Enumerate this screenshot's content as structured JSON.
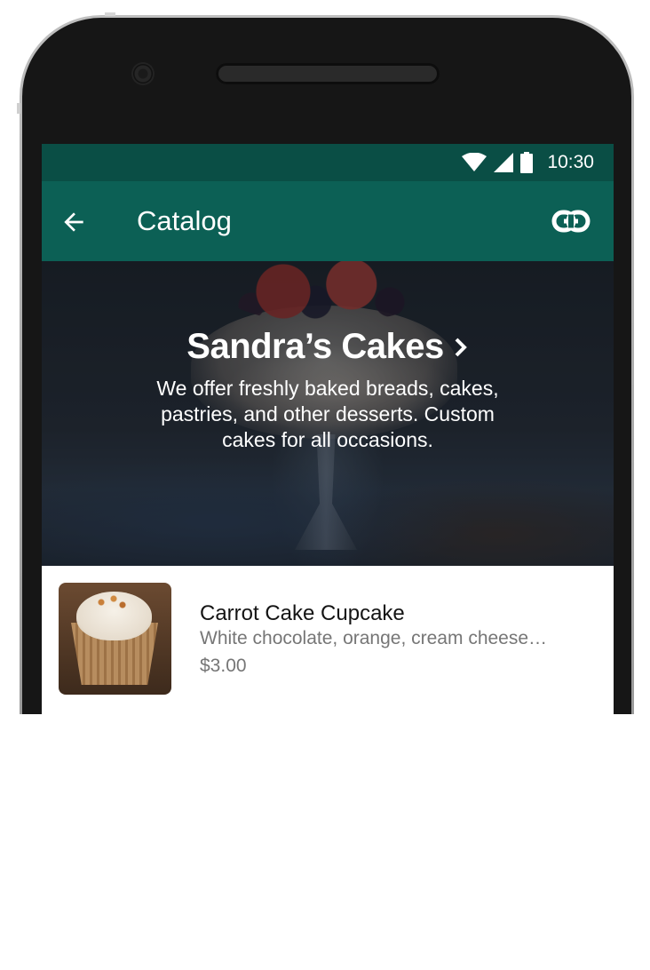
{
  "status_bar": {
    "time": "10:30"
  },
  "app_bar": {
    "title": "Catalog"
  },
  "hero": {
    "business_name": "Sandra’s Cakes",
    "description": "We offer freshly baked breads, cakes, pastries, and other desserts. Custom cakes for all occasions."
  },
  "products": [
    {
      "name": "Carrot Cake Cupcake",
      "description": "White chocolate, orange, cream cheese…",
      "price": "$3.00"
    }
  ],
  "colors": {
    "status_bar": "#0a4e45",
    "app_bar": "#0c6055",
    "text_secondary": "#767676"
  },
  "icons": {
    "back": "arrow-back-icon",
    "link": "link-icon",
    "wifi": "wifi-icon",
    "signal": "signal-icon",
    "battery": "battery-icon",
    "chevron": "chevron-right-icon"
  }
}
